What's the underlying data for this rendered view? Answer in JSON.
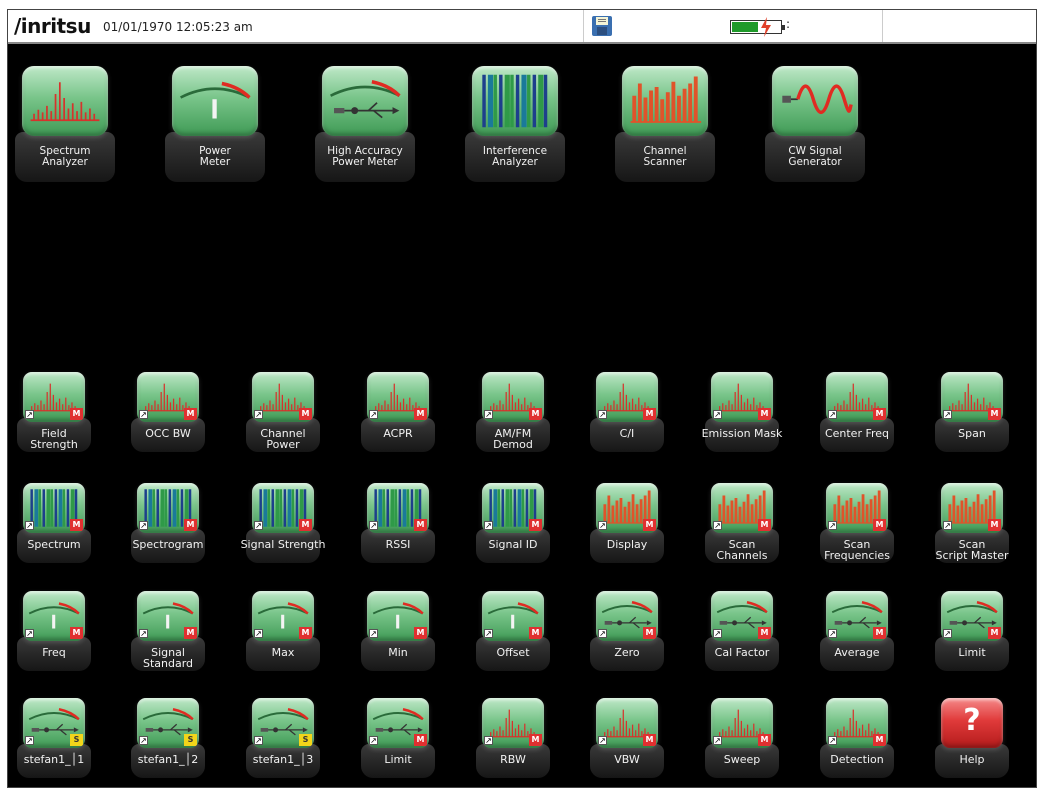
{
  "statusbar": {
    "logo": "/inritsu",
    "datetime": "01/01/1970 12:05:23 am",
    "battery_level": 0.55,
    "battery_suffix": ":"
  },
  "apps": [
    {
      "label": "Spectrum\nAnalyzer",
      "icon": "spectrum-icon"
    },
    {
      "label": "Power\nMeter",
      "icon": "meter-icon"
    },
    {
      "label": "High Accuracy\nPower Meter",
      "icon": "meter-usb-icon"
    },
    {
      "label": "Interference\nAnalyzer",
      "icon": "interference-icon"
    },
    {
      "label": "Channel\nScanner",
      "icon": "scanner-icon"
    },
    {
      "label": "CW Signal\nGenerator",
      "icon": "cw-icon"
    }
  ],
  "shortcut_rows": [
    [
      {
        "label": "Field\nStrength",
        "icon": "spectrum-icon",
        "badge": "M"
      },
      {
        "label": "OCC BW",
        "icon": "spectrum-icon",
        "badge": "M"
      },
      {
        "label": "Channel\nPower",
        "icon": "spectrum-icon",
        "badge": "M"
      },
      {
        "label": "ACPR",
        "icon": "spectrum-icon",
        "badge": "M"
      },
      {
        "label": "AM/FM\nDemod",
        "icon": "spectrum-icon",
        "badge": "M"
      },
      {
        "label": "C/I",
        "icon": "spectrum-icon",
        "badge": "M"
      },
      {
        "label": "Emission Mask",
        "icon": "spectrum-icon",
        "badge": "M"
      },
      {
        "label": "Center Freq",
        "icon": "spectrum-icon",
        "badge": "M"
      },
      {
        "label": "Span",
        "icon": "spectrum-icon",
        "badge": "M"
      }
    ],
    [
      {
        "label": "Spectrum",
        "icon": "interference-icon",
        "badge": "M"
      },
      {
        "label": "Spectrogram",
        "icon": "interference-icon",
        "badge": "M"
      },
      {
        "label": "Signal Strength",
        "icon": "interference-icon",
        "badge": "M"
      },
      {
        "label": "RSSI",
        "icon": "interference-icon",
        "badge": "M"
      },
      {
        "label": "Signal ID",
        "icon": "interference-icon",
        "badge": "M"
      },
      {
        "label": "Display",
        "icon": "scanner-icon",
        "badge": "M"
      },
      {
        "label": "Scan\nChannels",
        "icon": "scanner-icon",
        "badge": "M"
      },
      {
        "label": "Scan\nFrequencies",
        "icon": "scanner-icon",
        "badge": "M"
      },
      {
        "label": "Scan\nScript Master",
        "icon": "scanner-icon",
        "badge": "M"
      }
    ],
    [
      {
        "label": "Freq",
        "icon": "meter-icon",
        "badge": "M"
      },
      {
        "label": "Signal\nStandard",
        "icon": "meter-icon",
        "badge": "M"
      },
      {
        "label": "Max",
        "icon": "meter-icon",
        "badge": "M"
      },
      {
        "label": "Min",
        "icon": "meter-icon",
        "badge": "M"
      },
      {
        "label": "Offset",
        "icon": "meter-icon",
        "badge": "M"
      },
      {
        "label": "Zero",
        "icon": "meter-usb-icon",
        "badge": "M"
      },
      {
        "label": "Cal Factor",
        "icon": "meter-usb-icon",
        "badge": "M"
      },
      {
        "label": "Average",
        "icon": "meter-usb-icon",
        "badge": "M"
      },
      {
        "label": "Limit",
        "icon": "meter-usb-icon",
        "badge": "M"
      }
    ],
    [
      {
        "label": "stefan1_│1",
        "icon": "meter-usb-icon",
        "badge": "S"
      },
      {
        "label": "stefan1_│2",
        "icon": "meter-usb-icon",
        "badge": "S"
      },
      {
        "label": "stefan1_│3",
        "icon": "meter-usb-icon",
        "badge": "S"
      },
      {
        "label": "Limit",
        "icon": "meter-usb-icon",
        "badge": "M"
      },
      {
        "label": "RBW",
        "icon": "spectrum-icon",
        "badge": "M"
      },
      {
        "label": "VBW",
        "icon": "spectrum-icon",
        "badge": "M"
      },
      {
        "label": "Sweep",
        "icon": "spectrum-icon",
        "badge": "M"
      },
      {
        "label": "Detection",
        "icon": "spectrum-icon",
        "badge": "M"
      },
      {
        "label": "Help",
        "icon": "help-icon",
        "badge": ""
      }
    ]
  ],
  "help_glyph": "?"
}
